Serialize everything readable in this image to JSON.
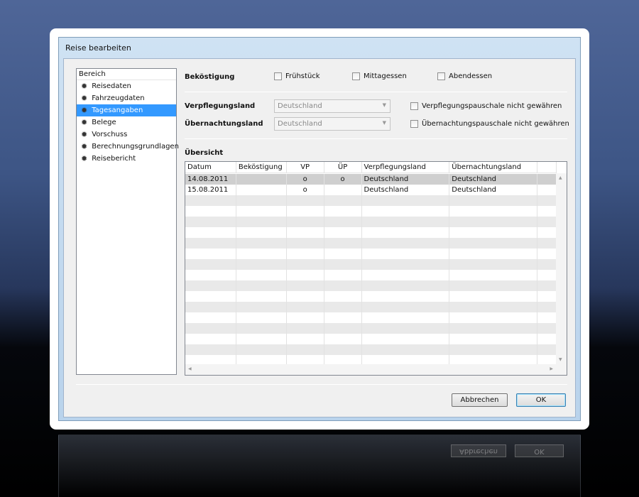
{
  "dialog": {
    "title": "Reise bearbeiten"
  },
  "nav": {
    "header": "Bereich",
    "items": [
      {
        "label": "Reisedaten"
      },
      {
        "label": "Fahrzeugdaten"
      },
      {
        "label": "Tagesangaben",
        "selected": true
      },
      {
        "label": "Belege"
      },
      {
        "label": "Vorschuss"
      },
      {
        "label": "Berechnungsgrundlagen"
      },
      {
        "label": "Reisebericht"
      }
    ]
  },
  "form": {
    "bekoestigung_label": "Beköstigung",
    "fruehstueck": "Frühstück",
    "mittagessen": "Mittagessen",
    "abendessen": "Abendessen",
    "verpflegungsland_label": "Verpflegungsland",
    "verpflegungsland_value": "Deutschland",
    "uebernachtungsland_label": "Übernachtungsland",
    "uebernachtungsland_value": "Deutschland",
    "vp_nicht": "Verpflegungspauschale nicht gewähren",
    "up_nicht": "Übernachtungspauschale nicht gewähren",
    "uebersicht_label": "Übersicht"
  },
  "table": {
    "columns": [
      "Datum",
      "Beköstigung",
      "VP",
      "ÜP",
      "Verpflegungsland",
      "Übernachtungsland"
    ],
    "rows": [
      [
        "14.08.2011",
        "",
        "o",
        "o",
        "Deutschland",
        "Deutschland"
      ],
      [
        "15.08.2011",
        "",
        "o",
        "",
        "Deutschland",
        "Deutschland"
      ]
    ]
  },
  "buttons": {
    "cancel": "Abbrechen",
    "ok": "OK"
  }
}
